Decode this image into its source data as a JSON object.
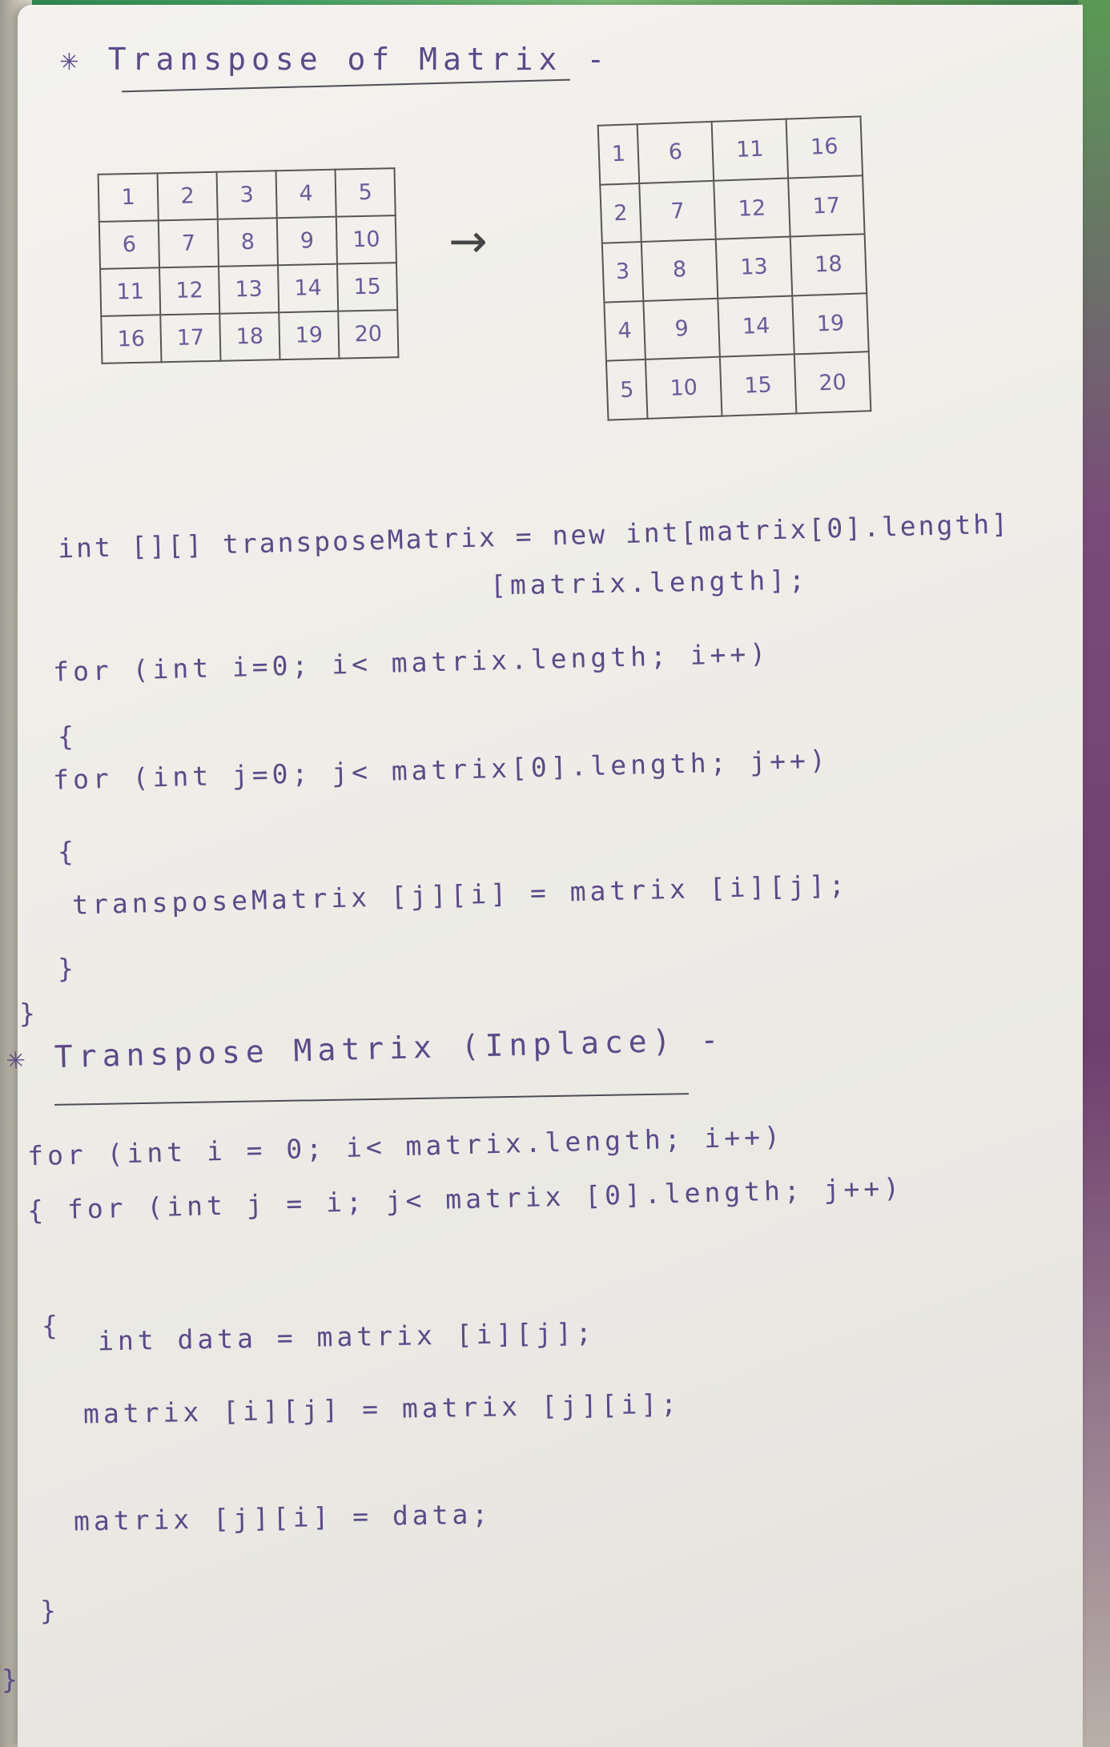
{
  "section1": {
    "title": "✳ Transpose of Matrix -",
    "matrix": [
      [
        "1",
        "2",
        "3",
        "4",
        "5"
      ],
      [
        "6",
        "7",
        "8",
        "9",
        "10"
      ],
      [
        "11",
        "12",
        "13",
        "14",
        "15"
      ],
      [
        "16",
        "17",
        "18",
        "19",
        "20"
      ]
    ],
    "arrow": "→",
    "transposed": [
      [
        "1",
        "6",
        "11",
        "16"
      ],
      [
        "2",
        "7",
        "12",
        "17"
      ],
      [
        "3",
        "8",
        "13",
        "18"
      ],
      [
        "4",
        "9",
        "14",
        "19"
      ],
      [
        "5",
        "10",
        "15",
        "20"
      ]
    ],
    "code": [
      "int [][] transposeMatrix = new int[matrix[0].length]",
      "[matrix.length];",
      "for (int i=0; i< matrix.length; i++)",
      "{",
      "for (int j=0; j< matrix[0].length; j++)",
      "{",
      "transposeMatrix [j][i] = matrix [i][j];",
      "}",
      "}"
    ]
  },
  "section2": {
    "title": "✳ Transpose Matrix (Inplace) -",
    "code": [
      "for (int i = 0; i< matrix.length; i++)",
      "{ for (int j = i; j< matrix [0].length; j++)",
      "{",
      "int data = matrix [i][j];",
      "matrix [i][j] = matrix [j][i];",
      "matrix [j][i] = data;",
      "}",
      "}"
    ]
  }
}
